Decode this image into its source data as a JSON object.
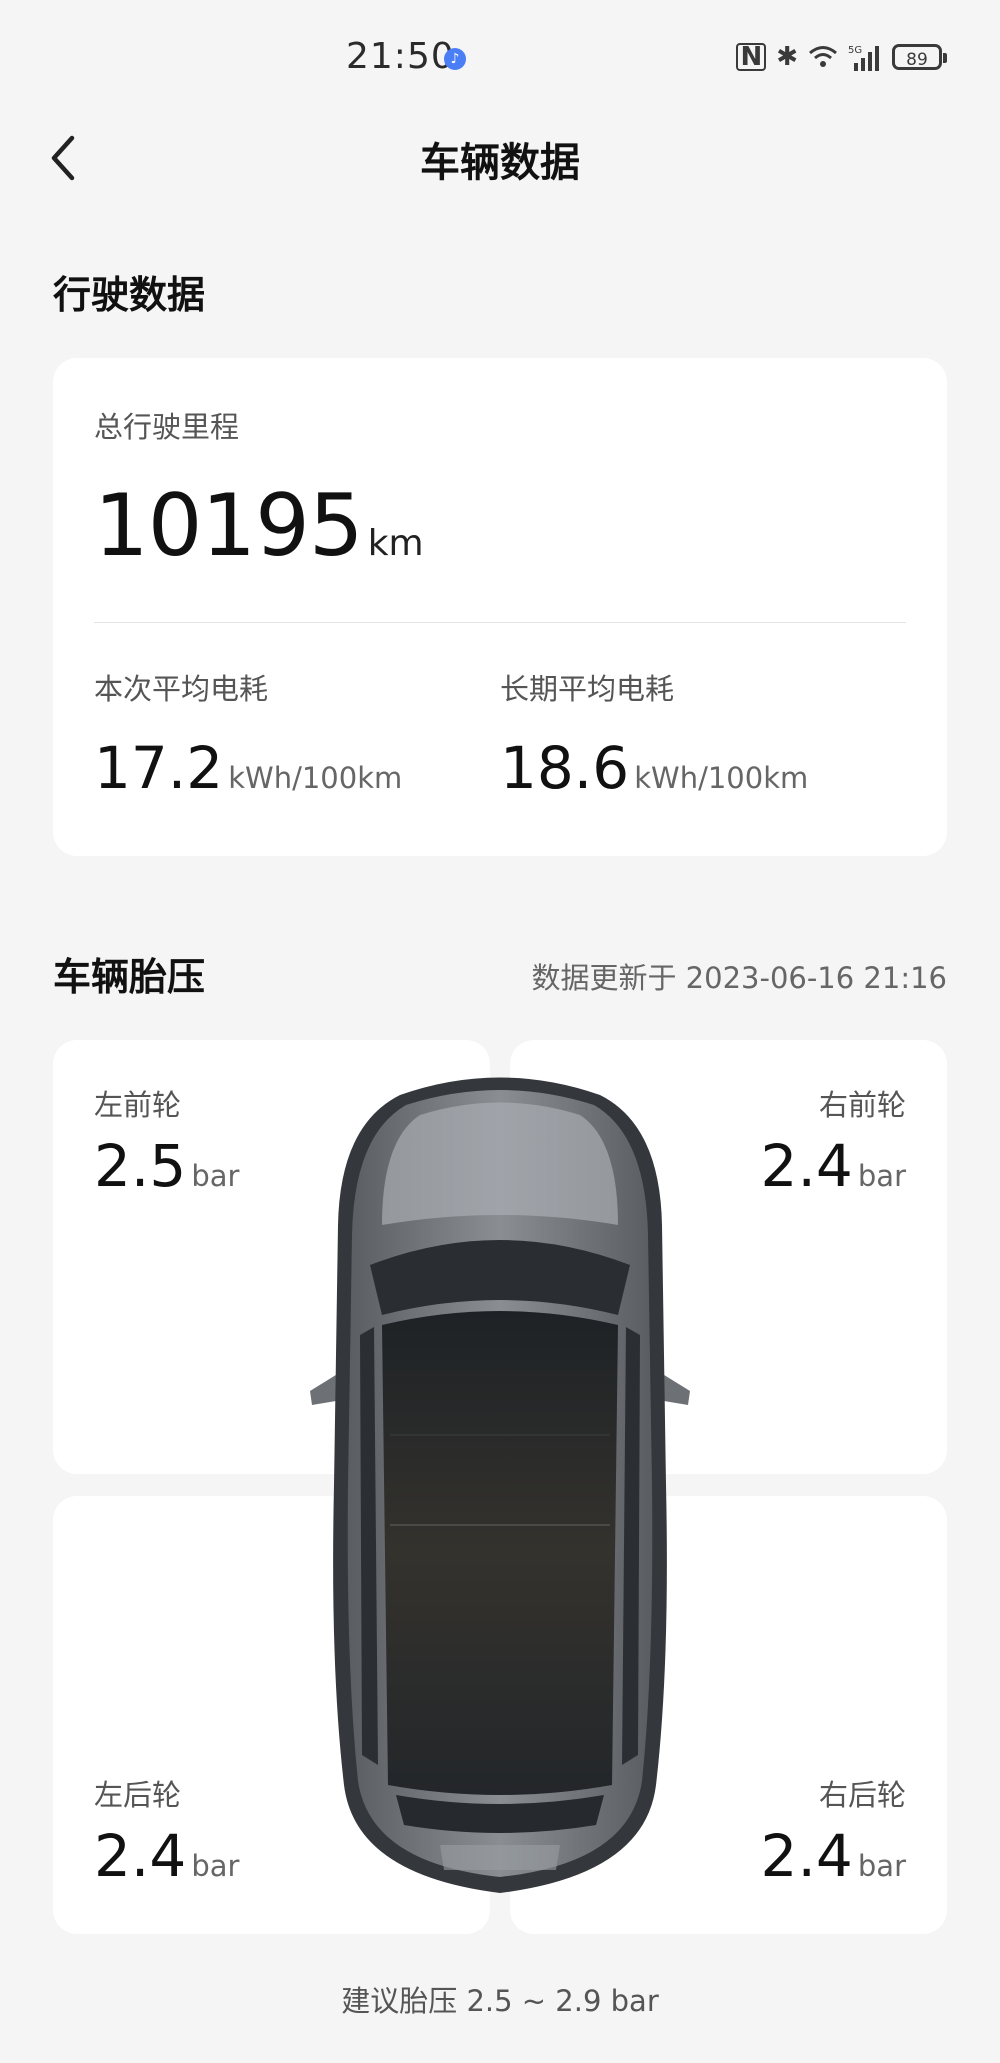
{
  "status_bar": {
    "time": "21:50",
    "battery": "89"
  },
  "nav": {
    "title": "车辆数据"
  },
  "driving": {
    "section_title": "行驶数据",
    "total_label": "总行驶里程",
    "total_value": "10195",
    "total_unit": "km",
    "current_label": "本次平均电耗",
    "current_value": "17.2",
    "current_unit": "kWh/100km",
    "longterm_label": "长期平均电耗",
    "longterm_value": "18.6",
    "longterm_unit": "kWh/100km"
  },
  "tires": {
    "section_title": "车辆胎压",
    "updated": "数据更新于 2023-06-16 21:16",
    "front_left": {
      "label": "左前轮",
      "value": "2.5",
      "unit": "bar"
    },
    "front_right": {
      "label": "右前轮",
      "value": "2.4",
      "unit": "bar"
    },
    "rear_left": {
      "label": "左后轮",
      "value": "2.4",
      "unit": "bar"
    },
    "rear_right": {
      "label": "右后轮",
      "value": "2.4",
      "unit": "bar"
    },
    "recommend": "建议胎压 2.5 ~ 2.9 bar"
  },
  "colors": {
    "background": "#f5f5f5",
    "card": "#ffffff",
    "accent": "#4a7ef6"
  }
}
